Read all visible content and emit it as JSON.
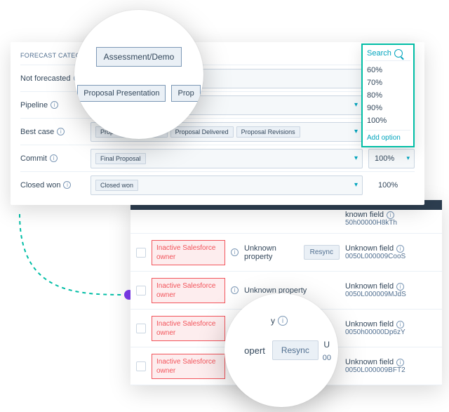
{
  "colors": {
    "accent": "#00a4bd",
    "teal": "#00bda5",
    "danger": "#f2545b"
  },
  "forecast": {
    "header": "FORECAST CATEGORY",
    "rows": [
      {
        "label": "Not forecasted",
        "chips": [],
        "pct": ""
      },
      {
        "label": "Pipeline",
        "chips": [],
        "pct": ""
      },
      {
        "label": "Best case",
        "chips": [
          "Proposal Presentation",
          "Proposal Delivered",
          "Proposal Revisions"
        ],
        "pct": ""
      },
      {
        "label": "Commit",
        "chips": [
          "Final Proposal"
        ],
        "pct_selected": "100%"
      },
      {
        "label": "Closed won",
        "chips": [
          "Closed won"
        ],
        "pct": "100%"
      }
    ]
  },
  "dropdown": {
    "search_placeholder": "Search",
    "items": [
      "60%",
      "70%",
      "80%",
      "90%",
      "100%"
    ],
    "add_option": "Add option"
  },
  "magnify_top": {
    "chip_large": "Assessment/Demo",
    "chip_a": "Proposal Presentation",
    "chip_b": "Prop"
  },
  "magnify_bottom": {
    "y_top": "y",
    "opert": "opert",
    "resync": "Resync",
    "u_right": "U",
    "zeros": "00"
  },
  "table": {
    "badge": "Inactive Salesforce owner",
    "unknown_property": "Unknown property",
    "unknown_field_top": "known field",
    "unknown_field": "Unknown field",
    "resync": "Resync",
    "rows": [
      {
        "id_top": "50h00000H8kTh",
        "show_resync": false,
        "show_checkbox": false,
        "top_cut": true
      },
      {
        "id": "0050L000009CooS",
        "show_resync": true
      },
      {
        "id": "0050L000009MJdS",
        "show_resync": false
      },
      {
        "id": "0050h00000Dp6zY",
        "show_resync": false
      },
      {
        "id": "0050L000009BFT2",
        "show_resync": false
      }
    ]
  }
}
